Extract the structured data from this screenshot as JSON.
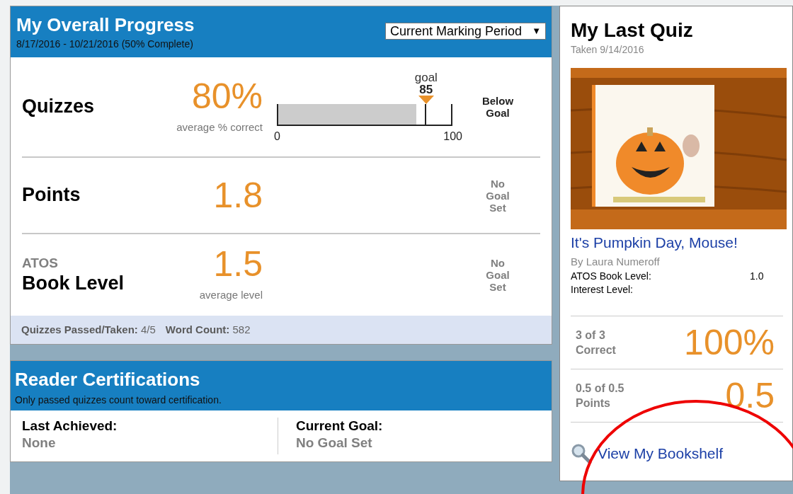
{
  "progress": {
    "title": "My Overall Progress",
    "subtitle": "8/17/2016 - 10/21/2016 (50% Complete)",
    "period_select": {
      "value": "Current Marking Period",
      "caret": "▼"
    },
    "metrics": [
      {
        "kind": "bar",
        "label": "Quizzes",
        "value": "80%",
        "caption": "average % correct",
        "bar": {
          "level": 0.8,
          "goal_label": "goal",
          "goal_value": "85",
          "min": "0",
          "max": "100"
        },
        "status": "Below Goal"
      },
      {
        "kind": "plain",
        "label": "Points",
        "value": "1.8",
        "status": "No Goal Set"
      },
      {
        "kind": "plain",
        "overline": "ATOS",
        "label": "Book Level",
        "value": "1.5",
        "caption": "average level",
        "status": "No Goal Set"
      }
    ],
    "footer": [
      {
        "label": "Quizzes Passed/Taken:",
        "value": "4/5"
      },
      {
        "label": "Word Count:",
        "value": "582"
      }
    ]
  },
  "certifications": {
    "title": "Reader Certifications",
    "subtitle": "Only passed quizzes count toward certification.",
    "items": [
      {
        "label": "Last Achieved:",
        "value": "None"
      },
      {
        "label": "Current Goal:",
        "value": "No Goal Set"
      }
    ]
  },
  "last_quiz": {
    "title": "My Last Quiz",
    "taken": "Taken 9/14/2016",
    "book_title": "It's Pumpkin Day, Mouse!",
    "author": "By Laura Numeroff",
    "details": [
      {
        "label": "ATOS Book Level:",
        "value": "1.0"
      },
      {
        "label": "Interest Level:"
      }
    ],
    "stats": [
      {
        "line1": "3 of 3",
        "line2": "Correct",
        "value": "100%"
      },
      {
        "line1": "0.5 of 0.5",
        "line2": "Points",
        "value": "0.5"
      }
    ],
    "bookshelf_link": "View My Bookshelf"
  },
  "annotation": {
    "kind": "ellipse"
  }
}
